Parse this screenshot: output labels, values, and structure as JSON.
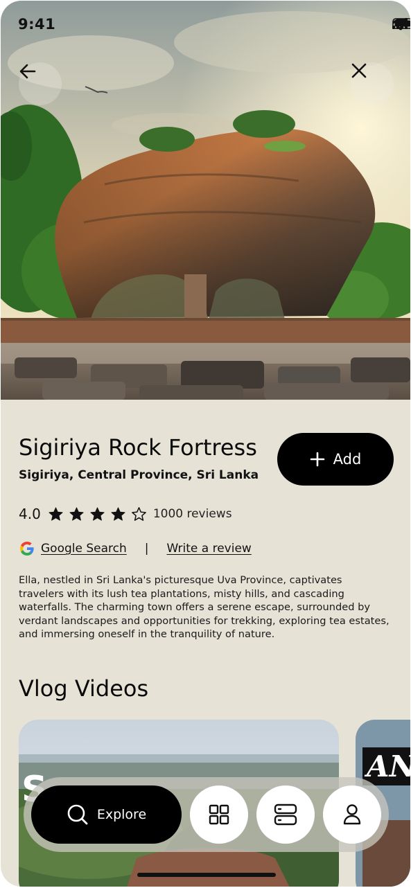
{
  "status_bar": {
    "time": "9:41"
  },
  "place": {
    "name": "Sigiriya Rock Fortress",
    "location": "Sigiriya, Central Province, Sri Lanka",
    "add_label": "Add",
    "rating": "4.0",
    "rating_stars": 4,
    "rating_stars_max": 5,
    "reviews_label": "1000 reviews",
    "google_search_label": "Google Search",
    "separator": "|",
    "write_review_label": "Write a review",
    "description": "Ella, nestled in Sri Lanka's picturesque Uva Province, captivates travelers with its lush tea plantations, misty hills, and cascading waterfalls. The charming town offers a serene escape, surrounded by verdant landscapes and opportunities for trekking, exploring tea estates, and immersing oneself in the tranquility of nature."
  },
  "vlog": {
    "section_title": "Vlog Videos",
    "cards": [
      {
        "overlay_text": "S"
      },
      {
        "overlay_text": "AN"
      }
    ]
  },
  "bottom_nav": {
    "explore_label": "Explore",
    "icons": [
      "search-icon",
      "grid-icon",
      "server-icon",
      "user-icon"
    ]
  },
  "colors": {
    "background": "#e6e3d6",
    "primary": "#000000",
    "on_primary": "#ffffff"
  }
}
